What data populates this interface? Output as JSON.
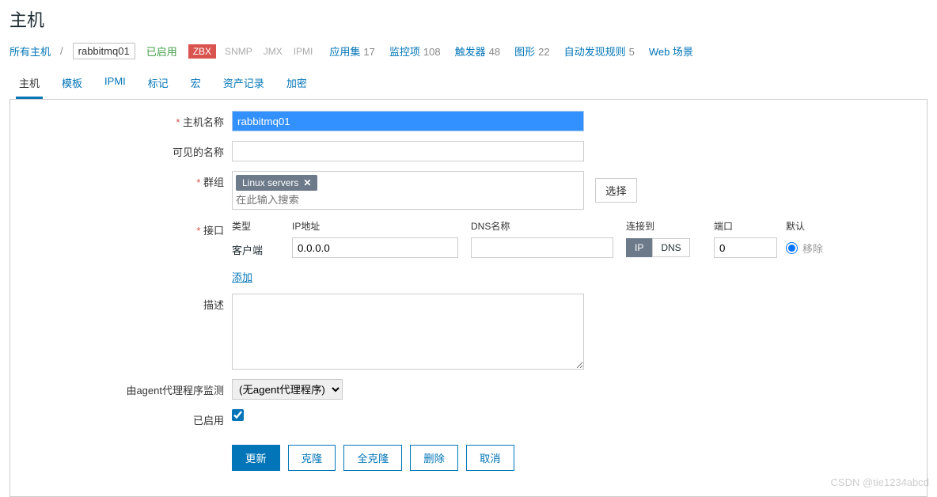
{
  "page": {
    "title": "主机"
  },
  "breadcrumb": {
    "all_hosts": "所有主机",
    "host": "rabbitmq01"
  },
  "status": {
    "enabled": "已启用",
    "zbx": "ZBX",
    "snmp": "SNMP",
    "jmx": "JMX",
    "ipmi": "IPMI"
  },
  "nav_stats": [
    {
      "label": "应用集",
      "count": "17"
    },
    {
      "label": "监控项",
      "count": "108"
    },
    {
      "label": "触发器",
      "count": "48"
    },
    {
      "label": "图形",
      "count": "22"
    },
    {
      "label": "自动发现规则",
      "count": "5"
    },
    {
      "label": "Web 场景",
      "count": ""
    }
  ],
  "tabs": [
    "主机",
    "模板",
    "IPMI",
    "标记",
    "宏",
    "资产记录",
    "加密"
  ],
  "form": {
    "host_name": {
      "label": "主机名称",
      "value": "rabbitmq01"
    },
    "visible_name": {
      "label": "可见的名称",
      "value": ""
    },
    "groups": {
      "label": "群组",
      "tag": "Linux servers",
      "placeholder": "在此输入搜索",
      "select": "选择"
    },
    "interfaces": {
      "label": "接口",
      "headers": {
        "type": "类型",
        "ip": "IP地址",
        "dns": "DNS名称",
        "connect": "连接到",
        "port": "端口",
        "default": "默认"
      },
      "agent": "客户端",
      "ip_value": "0.0.0.0",
      "dns_value": "",
      "ip_seg": "IP",
      "dns_seg": "DNS",
      "port": "0",
      "remove": "移除",
      "add": "添加"
    },
    "description": {
      "label": "描述",
      "value": ""
    },
    "proxy": {
      "label": "由agent代理程序监测",
      "value": "(无agent代理程序)"
    },
    "enabled": {
      "label": "已启用"
    },
    "buttons": {
      "update": "更新",
      "clone": "克隆",
      "full_clone": "全克隆",
      "delete": "删除",
      "cancel": "取消"
    }
  },
  "watermark": "CSDN @tie1234abcd"
}
